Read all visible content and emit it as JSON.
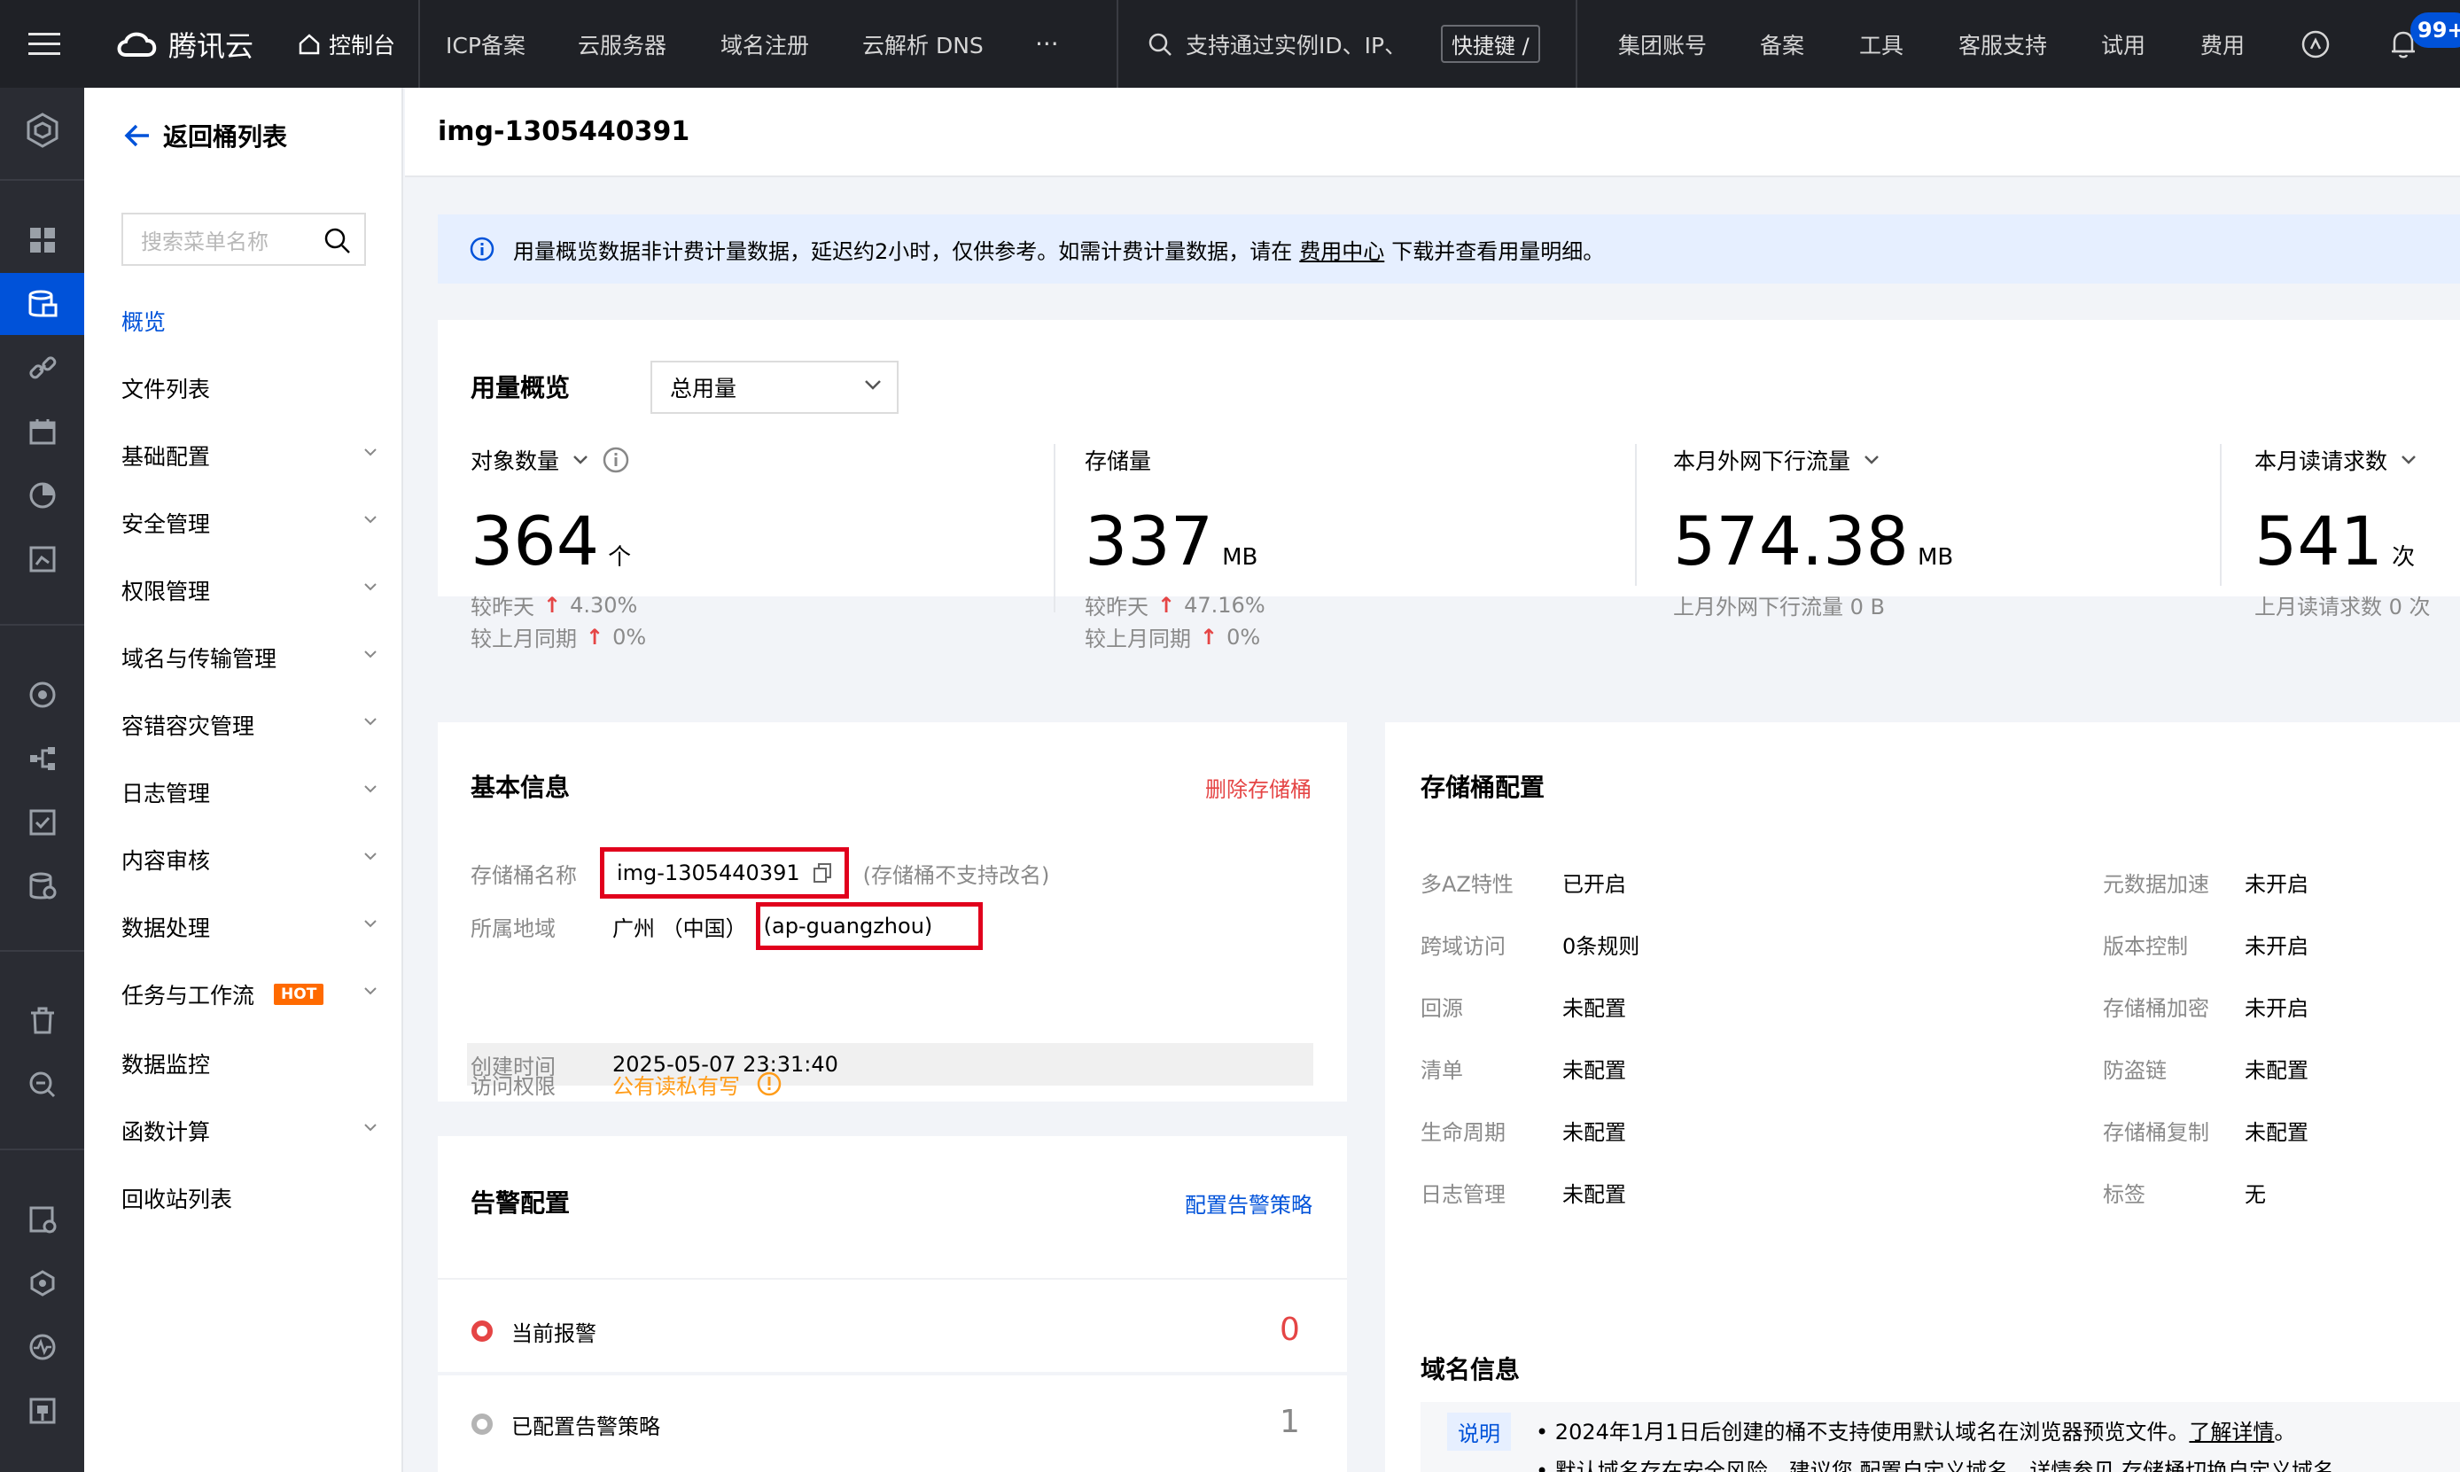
{
  "topbar": {
    "brand": "腾讯云",
    "console": "控制台",
    "nav": [
      "ICP备案",
      "云服务器",
      "域名注册",
      "云解析 DNS"
    ],
    "more": "···",
    "search_placeholder": "支持通过实例ID、IP、",
    "shortcut": "快捷键 /",
    "right": [
      "集团账号",
      "备案",
      "工具",
      "客服支持",
      "试用",
      "费用"
    ],
    "notify_count": "99+"
  },
  "sidebar": {
    "back_label": "返回桶列表",
    "search_placeholder": "搜索菜单名称",
    "items": [
      {
        "label": "概览"
      },
      {
        "label": "文件列表"
      },
      {
        "label": "基础配置"
      },
      {
        "label": "安全管理"
      },
      {
        "label": "权限管理"
      },
      {
        "label": "域名与传输管理"
      },
      {
        "label": "容错容灾管理"
      },
      {
        "label": "日志管理"
      },
      {
        "label": "内容审核"
      },
      {
        "label": "数据处理"
      },
      {
        "label": "任务与工作流"
      },
      {
        "label": "数据监控"
      },
      {
        "label": "函数计算"
      },
      {
        "label": "回收站列表"
      }
    ],
    "hot": "HOT"
  },
  "page": {
    "title": "img-1305440391",
    "notice_pre": "用量概览数据非计费计量数据，延迟约2小时，仅供参考。如需计费计量数据，请在",
    "notice_link": "费用中心",
    "notice_post": "下载并查看用量明细。"
  },
  "usage": {
    "title": "用量概览",
    "select": "总用量",
    "metrics": [
      {
        "label": "对象数量",
        "value": "364",
        "unit": "个",
        "sub1_label": "较昨天",
        "sub1_value": "4.30%",
        "sub2_label": "较上月同期",
        "sub2_value": "0%"
      },
      {
        "label": "存储量",
        "value": "337",
        "unit": "MB",
        "sub1_label": "较昨天",
        "sub1_value": "47.16%",
        "sub2_label": "较上月同期",
        "sub2_value": "0%"
      },
      {
        "label": "本月外网下行流量",
        "value": "574.38",
        "unit": "MB",
        "sub1_text": "上月外网下行流量 0 B"
      },
      {
        "label": "本月读请求数",
        "value": "541",
        "unit": "次",
        "sub1_text": "上月读请求数 0 次"
      }
    ]
  },
  "basic": {
    "title": "基本信息",
    "delete": "删除存储桶",
    "name_label": "存储桶名称",
    "name_value": "img-1305440391",
    "name_hint": "(存储桶不支持改名)",
    "region_label": "所属地域",
    "region_value": "广州 （中国）",
    "region_code": "(ap-guangzhou)",
    "created_label": "创建时间",
    "created_value": "2025-05-07 23:31:40",
    "access_label": "访问权限",
    "access_value": "公有读私有写"
  },
  "alarm": {
    "title": "告警配置",
    "link": "配置告警策略",
    "current_label": "当前报警",
    "current_value": "0",
    "configured_label": "已配置告警策略",
    "configured_value": "1"
  },
  "storage": {
    "title": "存储桶配置",
    "left": [
      {
        "k": "多AZ特性",
        "v": "已开启"
      },
      {
        "k": "跨域访问",
        "v": "0条规则"
      },
      {
        "k": "回源",
        "v": "未配置"
      },
      {
        "k": "清单",
        "v": "未配置"
      },
      {
        "k": "生命周期",
        "v": "未配置"
      },
      {
        "k": "日志管理",
        "v": "未配置"
      }
    ],
    "right": [
      {
        "k": "元数据加速",
        "v": "未开启"
      },
      {
        "k": "版本控制",
        "v": "未开启"
      },
      {
        "k": "存储桶加密",
        "v": "未开启"
      },
      {
        "k": "防盗链",
        "v": "未配置"
      },
      {
        "k": "存储桶复制",
        "v": "未配置"
      },
      {
        "k": "标签",
        "v": "无"
      }
    ]
  },
  "domain": {
    "title": "域名信息",
    "tag": "说明",
    "line1": "2024年1月1日后创建的桶不支持使用默认域名在浏览器预览文件。",
    "line1_link": "了解详情",
    "line1_end": "。",
    "line2": "默认域名存在安全风险，建议您 配置自定义域名。详情参见 存储桶切换自定义域名"
  },
  "colors": {
    "accent": "#0052d9",
    "danger": "#e54545",
    "warning": "#ff9c19",
    "highlight_box": "#e1001c"
  }
}
